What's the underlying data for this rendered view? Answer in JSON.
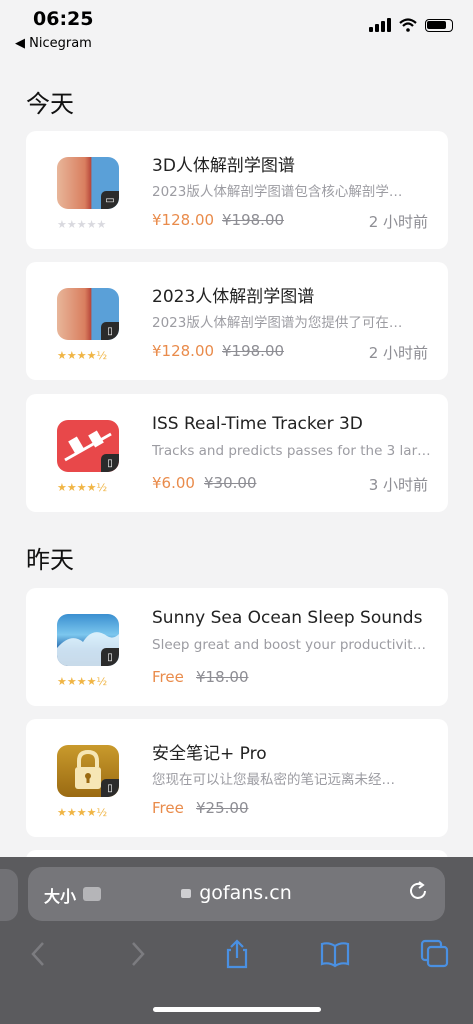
{
  "status": {
    "time": "06:25",
    "back_app": "◀ Nicegram"
  },
  "sections": [
    {
      "title": "今天"
    },
    {
      "title": "昨天"
    }
  ],
  "apps": [
    {
      "title": "3D人体解剖学图谱",
      "desc": "2023版人体解剖学图谱包含核心解剖学…",
      "price": "¥128.00",
      "orig": "¥198.00",
      "ago": "2 小时前",
      "stars": "★★★★★",
      "badge": "▭",
      "icon": "anatomy-face-icon"
    },
    {
      "title": "2023人体解剖学图谱",
      "desc": "2023版人体解剖学图谱为您提供了可在…",
      "price": "¥128.00",
      "orig": "¥198.00",
      "ago": "2 小时前",
      "stars": "★★★★½",
      "badge": "▯",
      "icon": "anatomy-face-icon"
    },
    {
      "title": "ISS Real-Time Tracker 3D",
      "desc": "Tracks and predicts passes for the 3 lar…",
      "price": "¥6.00",
      "orig": "¥30.00",
      "ago": "3 小时前",
      "stars": "★★★★½",
      "badge": "▯",
      "icon": "iss-tracker-icon"
    },
    {
      "title": "Sunny Sea Ocean Sleep Sounds",
      "desc": "Sleep great and boost your productivit…",
      "price": "Free",
      "orig": "¥18.00",
      "ago": "",
      "stars": "★★★★½",
      "badge": "▯",
      "icon": "ocean-wave-icon"
    },
    {
      "title": "安全笔记+ Pro",
      "desc": "您现在可以让您最私密的笔记远离未经…",
      "price": "Free",
      "orig": "¥25.00",
      "ago": "",
      "stars": "★★★★½",
      "badge": "▯",
      "icon": "padlock-icon"
    }
  ],
  "browser": {
    "aa_label": "大小",
    "url": "gofans.cn"
  },
  "colors": {
    "price": "#e98b4b",
    "star": "#f0b545",
    "toolbar": "#5b5b5e",
    "link_blue": "#4a90e2"
  }
}
